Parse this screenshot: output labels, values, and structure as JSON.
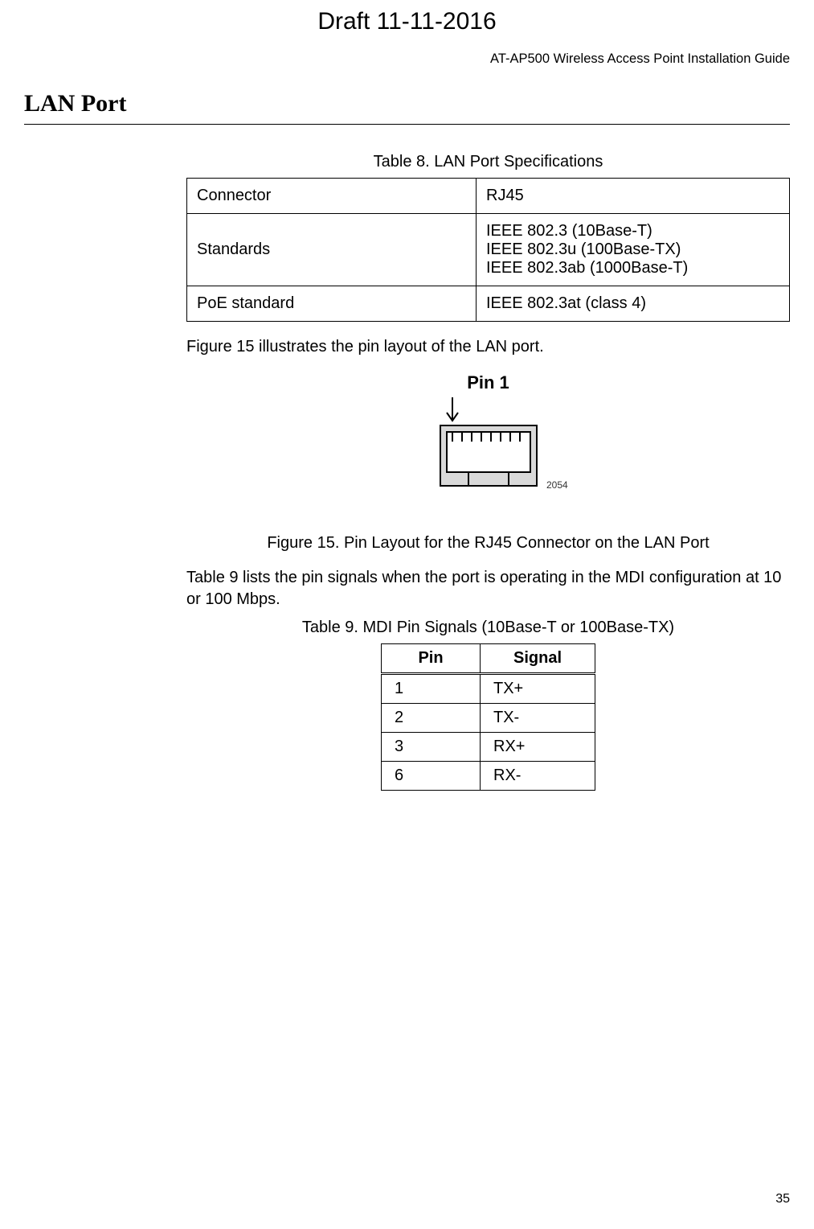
{
  "draft_stamp": "Draft 11-11-2016",
  "doc_header": "AT-AP500 Wireless Access Point Installation Guide",
  "section_title": "LAN Port",
  "table8": {
    "caption": "Table 8.   LAN Port Specifications",
    "rows": [
      {
        "label": "Connector",
        "value": "RJ45"
      },
      {
        "label": "Standards",
        "value": "IEEE 802.3 (10Base-T)\nIEEE 802.3u (100Base-TX)\nIEEE 802.3ab (1000Base-T)"
      },
      {
        "label": "PoE standard",
        "value": "IEEE 802.3at (class 4)"
      }
    ]
  },
  "para_fig15": "Figure 15 illustrates the pin layout of the LAN port.",
  "pin1_label": "Pin 1",
  "figure_image_id": "2054",
  "fig15_caption": "Figure 15. Pin Layout for the RJ45 Connector on the LAN Port",
  "para_table9": "Table 9 lists the pin signals when the port is operating in the MDI configuration at 10 or 100 Mbps.",
  "table9": {
    "caption": "Table 9.   MDI Pin Signals (10Base-T or 100Base-TX)",
    "headers": {
      "pin": "Pin",
      "signal": "Signal"
    },
    "rows": [
      {
        "pin": "1",
        "signal": "TX+"
      },
      {
        "pin": "2",
        "signal": "TX-"
      },
      {
        "pin": "3",
        "signal": "RX+"
      },
      {
        "pin": "6",
        "signal": "RX-"
      }
    ]
  },
  "page_number": "35"
}
